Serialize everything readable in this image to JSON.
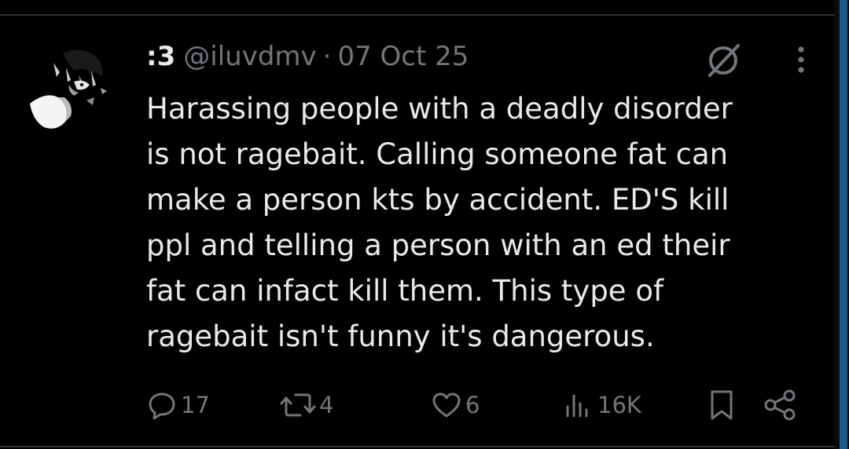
{
  "tweet": {
    "display_name": ":3",
    "handle": "@iluvdmv",
    "separator": "·",
    "date": "07 Oct 25",
    "text": "Harassing people with a deadly disorder\nis not ragebait. Calling someone fat can\nmake a person kts by accident. ED'S kill\nppl and telling a person with an ed their\nfat can infact kill them. This type of\nragebait isn't funny it's dangerous."
  },
  "actions": {
    "replies": "17",
    "retweets": "4",
    "likes": "6",
    "views": "16K"
  },
  "icons": {
    "header": [
      "mute-icon",
      "more-icon"
    ],
    "actions": [
      "reply-icon",
      "retweet-icon",
      "like-icon",
      "views-icon",
      "bookmark-icon",
      "share-icon"
    ]
  },
  "colors": {
    "background": "#000000",
    "text_primary": "#e7e9ea",
    "text_secondary": "#71767b",
    "divider": "#2f3336",
    "scrollbar": "#1d5d8e"
  }
}
